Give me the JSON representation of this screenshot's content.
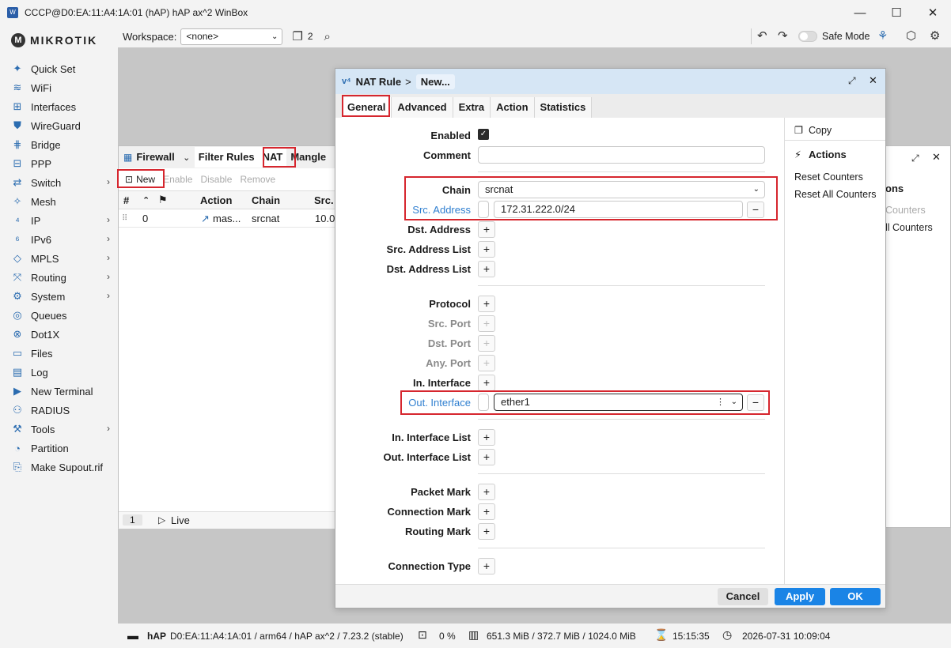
{
  "window": {
    "title": "CCCP@D0:EA:11:A4:1A:01 (hAP) hAP ax^2 WinBox",
    "app_icon": "W",
    "minimize": "—",
    "maximize": "☐",
    "close": "✕"
  },
  "logo": {
    "text": "MIKROTIK"
  },
  "sidebar": {
    "items": [
      {
        "label": "Quick Set",
        "icon": "✦",
        "sub": false
      },
      {
        "label": "WiFi",
        "icon": "≋",
        "sub": false
      },
      {
        "label": "Interfaces",
        "icon": "⊞",
        "sub": false
      },
      {
        "label": "WireGuard",
        "icon": "⛊",
        "sub": false
      },
      {
        "label": "Bridge",
        "icon": "⋕",
        "sub": false
      },
      {
        "label": "PPP",
        "icon": "⊟",
        "sub": false
      },
      {
        "label": "Switch",
        "icon": "⇄",
        "sub": true
      },
      {
        "label": "Mesh",
        "icon": "✧",
        "sub": false
      },
      {
        "label": "IP",
        "icon": "⁴",
        "sub": true
      },
      {
        "label": "IPv6",
        "icon": "⁶",
        "sub": true
      },
      {
        "label": "MPLS",
        "icon": "◇",
        "sub": true
      },
      {
        "label": "Routing",
        "icon": "⤧",
        "sub": true
      },
      {
        "label": "System",
        "icon": "⚙",
        "sub": true
      },
      {
        "label": "Queues",
        "icon": "◎",
        "sub": false
      },
      {
        "label": "Dot1X",
        "icon": "⊗",
        "sub": false
      },
      {
        "label": "Files",
        "icon": "▭",
        "sub": false
      },
      {
        "label": "Log",
        "icon": "▤",
        "sub": false
      },
      {
        "label": "New Terminal",
        "icon": "▶",
        "sub": false
      },
      {
        "label": "RADIUS",
        "icon": "⚇",
        "sub": false
      },
      {
        "label": "Tools",
        "icon": "⚒",
        "sub": true
      },
      {
        "label": "Partition",
        "icon": "◔",
        "sub": false
      },
      {
        "label": "Make Supout.rif",
        "icon": "⎘",
        "sub": false
      }
    ],
    "chevron": "›"
  },
  "toolbar": {
    "workspace_label": "Workspace:",
    "workspace_value": "<none>",
    "windows_count": "2",
    "safe_mode": "Safe Mode"
  },
  "firewall": {
    "title": "Firewall",
    "tabs": [
      "Filter Rules",
      "NAT",
      "Mangle"
    ],
    "actions": {
      "new": "New",
      "enable": "Enable",
      "disable": "Disable",
      "remove": "Remove"
    },
    "columns": [
      "#",
      "Action",
      "Chain",
      "Src."
    ],
    "row": {
      "num": "0",
      "action": "mas...",
      "chain": "srcnat",
      "src": "10.0"
    },
    "footer": {
      "count": "1",
      "live": "Live"
    }
  },
  "background_window": {
    "header": "ons",
    "item1": "Counters",
    "item2": "ll Counters"
  },
  "nat": {
    "breadcrumb_root": "NAT Rule",
    "breadcrumb_sep": ">",
    "breadcrumb_current": "New...",
    "tabs": [
      "General",
      "Advanced",
      "Extra",
      "Action",
      "Statistics"
    ],
    "fields": {
      "enabled": "Enabled",
      "comment": "Comment",
      "chain": "Chain",
      "chain_value": "srcnat",
      "src_address": "Src. Address",
      "src_address_value": "172.31.222.0/24",
      "dst_address": "Dst. Address",
      "src_address_list": "Src. Address List",
      "dst_address_list": "Dst. Address List",
      "protocol": "Protocol",
      "src_port": "Src. Port",
      "dst_port": "Dst. Port",
      "any_port": "Any. Port",
      "in_interface": "In. Interface",
      "out_interface": "Out. Interface",
      "out_interface_value": "ether1",
      "in_interface_list": "In. Interface List",
      "out_interface_list": "Out. Interface List",
      "packet_mark": "Packet Mark",
      "connection_mark": "Connection Mark",
      "routing_mark": "Routing Mark",
      "connection_type": "Connection Type"
    },
    "side": {
      "copy": "Copy",
      "actions_title": "Actions",
      "reset_counters": "Reset Counters",
      "reset_all_counters": "Reset All Counters"
    },
    "buttons": {
      "cancel": "Cancel",
      "apply": "Apply",
      "ok": "OK"
    }
  },
  "statusbar": {
    "device": "hAP",
    "info": "D0:EA:11:A4:1A:01 / arm64 / hAP ax^2 / 7.23.2 (stable)",
    "cpu": "0 %",
    "memory": "651.3 MiB / 372.7 MiB / 1024.0 MiB",
    "uptime": "15:15:35",
    "datetime": "2026-07-31 10:09:04"
  },
  "colors": {
    "accent": "#1a84e6",
    "highlight": "#d6262e",
    "title_blue": "#d6e6f5"
  }
}
